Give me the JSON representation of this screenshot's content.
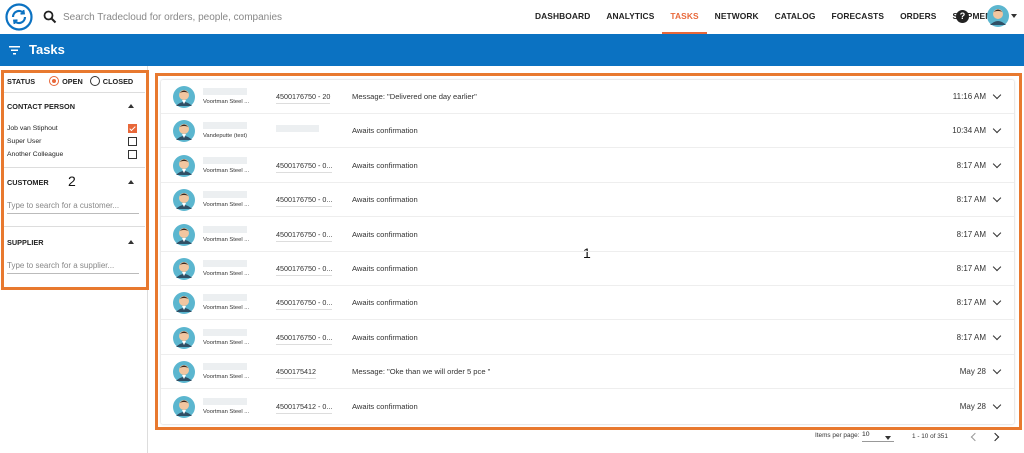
{
  "search": {
    "placeholder": "Search Tradecloud for orders, people, companies"
  },
  "nav": [
    "DASHBOARD",
    "ANALYTICS",
    "TASKS",
    "NETWORK",
    "CATALOG",
    "FORECASTS",
    "ORDERS",
    "SHIPMENTS"
  ],
  "nav_active": "TASKS",
  "help_label": "?",
  "page_title": "Tasks",
  "colors": {
    "brand_blue": "#0b72c2",
    "accent_orange": "#e8683a",
    "annotation_border": "#e8792f"
  },
  "filters": {
    "status_label": "STATUS",
    "status_open": "OPEN",
    "status_closed": "CLOSED",
    "status_selected": "OPEN",
    "contact_title": "CONTACT PERSON",
    "contacts": [
      {
        "name": "Job van Stiphout",
        "checked": true
      },
      {
        "name": "Super User",
        "checked": false
      },
      {
        "name": "Another Colleague",
        "checked": false
      }
    ],
    "customer_title": "CUSTOMER",
    "customer_placeholder": "Type to search for a customer...",
    "supplier_title": "SUPPLIER",
    "supplier_placeholder": "Type to search for a supplier..."
  },
  "annotations": {
    "left": "2",
    "right": "1"
  },
  "tasks": [
    {
      "company": "Voortman Steel ...",
      "order": "4500176750 - 20",
      "message": "Message: \"Delivered one day earlier\"",
      "time": "11:16 AM"
    },
    {
      "company": "Vandeputte (test)",
      "order": "",
      "message": "Awaits confirmation",
      "time": "10:34 AM"
    },
    {
      "company": "Voortman Steel ...",
      "order": "4500176750 - 0...",
      "message": "Awaits confirmation",
      "time": "8:17 AM"
    },
    {
      "company": "Voortman Steel ...",
      "order": "4500176750 - 0...",
      "message": "Awaits confirmation",
      "time": "8:17 AM"
    },
    {
      "company": "Voortman Steel ...",
      "order": "4500176750 - 0...",
      "message": "Awaits confirmation",
      "time": "8:17 AM"
    },
    {
      "company": "Voortman Steel ...",
      "order": "4500176750 - 0...",
      "message": "Awaits confirmation",
      "time": "8:17 AM"
    },
    {
      "company": "Voortman Steel ...",
      "order": "4500176750 - 0...",
      "message": "Awaits confirmation",
      "time": "8:17 AM"
    },
    {
      "company": "Voortman Steel ...",
      "order": "4500176750 - 0...",
      "message": "Awaits confirmation",
      "time": "8:17 AM"
    },
    {
      "company": "Voortman Steel ...",
      "order": "4500175412",
      "message": "Message: \"Oke than we will order 5 pce \"",
      "time": "May 28"
    },
    {
      "company": "Voortman Steel ...",
      "order": "4500175412 - 0...",
      "message": "Awaits confirmation",
      "time": "May 28"
    }
  ],
  "pagination": {
    "items_per_page_label": "Items per page:",
    "items_per_page": "10",
    "range": "1 - 10 of 351"
  }
}
